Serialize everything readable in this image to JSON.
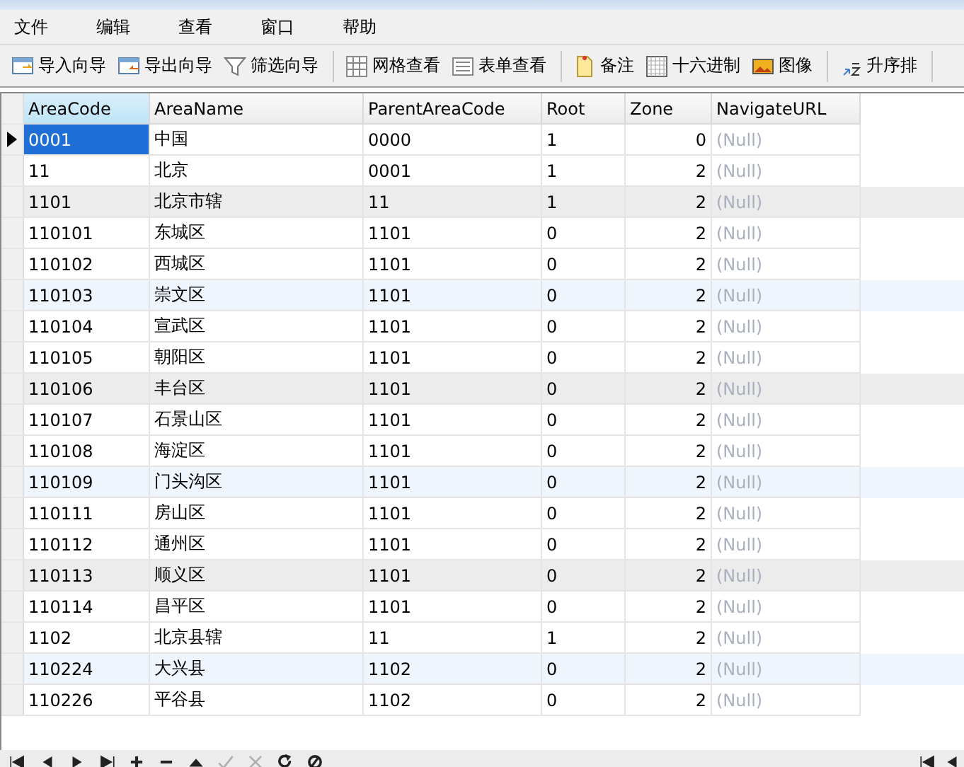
{
  "menu": [
    "文件",
    "编辑",
    "查看",
    "窗口",
    "帮助"
  ],
  "toolbar": [
    [
      "导入向导",
      "导出向导",
      "筛选向导"
    ],
    [
      "网格查看",
      "表单查看"
    ],
    [
      "备注",
      "十六进制",
      "图像"
    ],
    [
      "升序排"
    ]
  ],
  "table": {
    "columns": [
      "AreaCode",
      "AreaName",
      "ParentAreaCode",
      "Root",
      "Zone",
      "NavigateURL"
    ],
    "rows": [
      {
        "cells": [
          "0001",
          "中国",
          "0000",
          "1",
          "0",
          "(Null)"
        ],
        "selected": true,
        "color": "#ffffff"
      },
      {
        "cells": [
          "11",
          "北京",
          "0001",
          "1",
          "2",
          "(Null)"
        ],
        "selected": false,
        "color": "#ffffff"
      },
      {
        "cells": [
          "1101",
          "北京市辖",
          "11",
          "1",
          "2",
          "(Null)"
        ],
        "selected": false,
        "color": "#ececec"
      },
      {
        "cells": [
          "110101",
          "东城区",
          "1101",
          "0",
          "2",
          "(Null)"
        ],
        "selected": false,
        "color": "#ffffff"
      },
      {
        "cells": [
          "110102",
          "西城区",
          "1101",
          "0",
          "2",
          "(Null)"
        ],
        "selected": false,
        "color": "#ffffff"
      },
      {
        "cells": [
          "110103",
          "崇文区",
          "1101",
          "0",
          "2",
          "(Null)"
        ],
        "selected": false,
        "color": "#eef5fd"
      },
      {
        "cells": [
          "110104",
          "宣武区",
          "1101",
          "0",
          "2",
          "(Null)"
        ],
        "selected": false,
        "color": "#ffffff"
      },
      {
        "cells": [
          "110105",
          "朝阳区",
          "1101",
          "0",
          "2",
          "(Null)"
        ],
        "selected": false,
        "color": "#ffffff"
      },
      {
        "cells": [
          "110106",
          "丰台区",
          "1101",
          "0",
          "2",
          "(Null)"
        ],
        "selected": false,
        "color": "#ececec"
      },
      {
        "cells": [
          "110107",
          "石景山区",
          "1101",
          "0",
          "2",
          "(Null)"
        ],
        "selected": false,
        "color": "#ffffff"
      },
      {
        "cells": [
          "110108",
          "海淀区",
          "1101",
          "0",
          "2",
          "(Null)"
        ],
        "selected": false,
        "color": "#ffffff"
      },
      {
        "cells": [
          "110109",
          "门头沟区",
          "1101",
          "0",
          "2",
          "(Null)"
        ],
        "selected": false,
        "color": "#eef5fd"
      },
      {
        "cells": [
          "110111",
          "房山区",
          "1101",
          "0",
          "2",
          "(Null)"
        ],
        "selected": false,
        "color": "#ffffff"
      },
      {
        "cells": [
          "110112",
          "通州区",
          "1101",
          "0",
          "2",
          "(Null)"
        ],
        "selected": false,
        "color": "#ffffff"
      },
      {
        "cells": [
          "110113",
          "顺义区",
          "1101",
          "0",
          "2",
          "(Null)"
        ],
        "selected": false,
        "color": "#ececec"
      },
      {
        "cells": [
          "110114",
          "昌平区",
          "1101",
          "0",
          "2",
          "(Null)"
        ],
        "selected": false,
        "color": "#ffffff"
      },
      {
        "cells": [
          "1102",
          "北京县辖",
          "11",
          "1",
          "2",
          "(Null)"
        ],
        "selected": false,
        "color": "#ffffff"
      },
      {
        "cells": [
          "110224",
          "大兴县",
          "1102",
          "0",
          "2",
          "(Null)"
        ],
        "selected": false,
        "color": "#eef5fd"
      },
      {
        "cells": [
          "110226",
          "平谷县",
          "1102",
          "0",
          "2",
          "(Null)"
        ],
        "selected": false,
        "color": "#ffffff"
      }
    ]
  },
  "navigator": [
    {
      "disabled": false
    },
    {
      "disabled": false
    },
    {
      "disabled": false
    },
    {
      "disabled": false
    },
    {
      "disabled": false
    },
    {
      "disabled": false
    },
    {
      "disabled": false
    },
    {
      "disabled": true
    },
    {
      "disabled": true
    },
    {
      "disabled": false
    },
    {
      "disabled": false
    }
  ]
}
